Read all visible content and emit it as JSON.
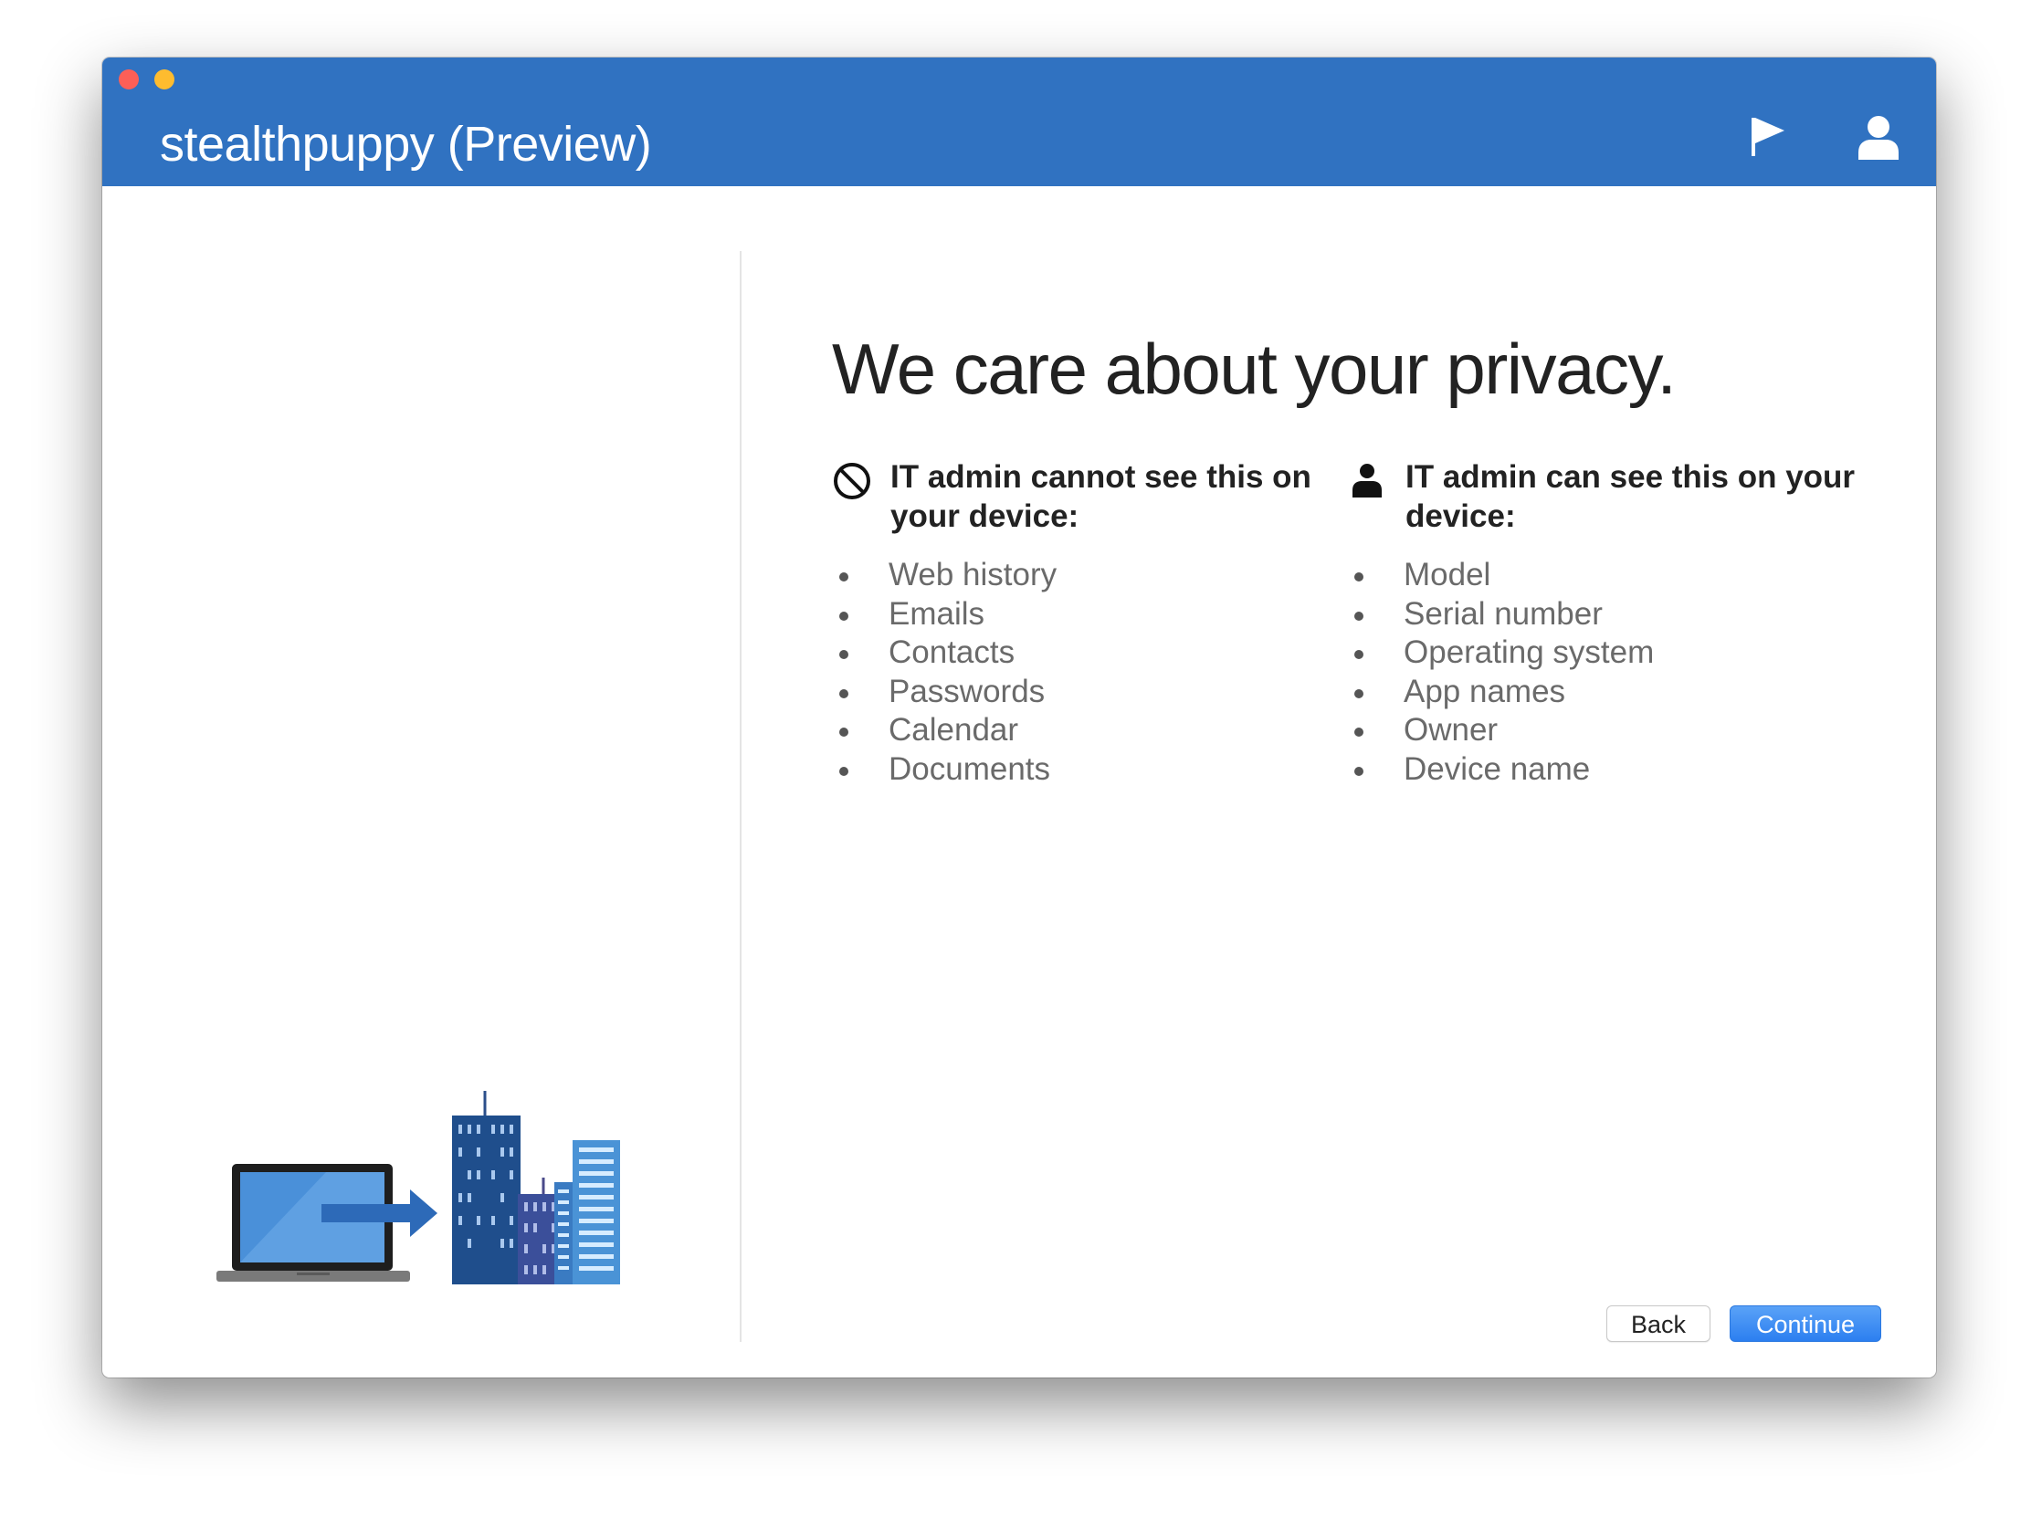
{
  "window": {
    "title": "stealthpuppy (Preview)"
  },
  "toolbar": {
    "flag_icon": "flag-icon",
    "user_icon": "person-icon"
  },
  "main": {
    "headline": "We care about your privacy.",
    "cannot_see": {
      "icon": "prohibited-icon",
      "heading": "IT admin cannot see this on your device:",
      "items": [
        "Web history",
        "Emails",
        "Contacts",
        "Passwords",
        "Calendar",
        "Documents"
      ]
    },
    "can_see": {
      "icon": "person-icon",
      "heading": "IT admin can see this on your device:",
      "items": [
        "Model",
        "Serial number",
        "Operating system",
        "App names",
        "Owner",
        "Device name"
      ]
    }
  },
  "footer": {
    "back_label": "Back",
    "continue_label": "Continue"
  },
  "colors": {
    "titlebar": "#3072c1",
    "accent": "#2c7ff0"
  }
}
